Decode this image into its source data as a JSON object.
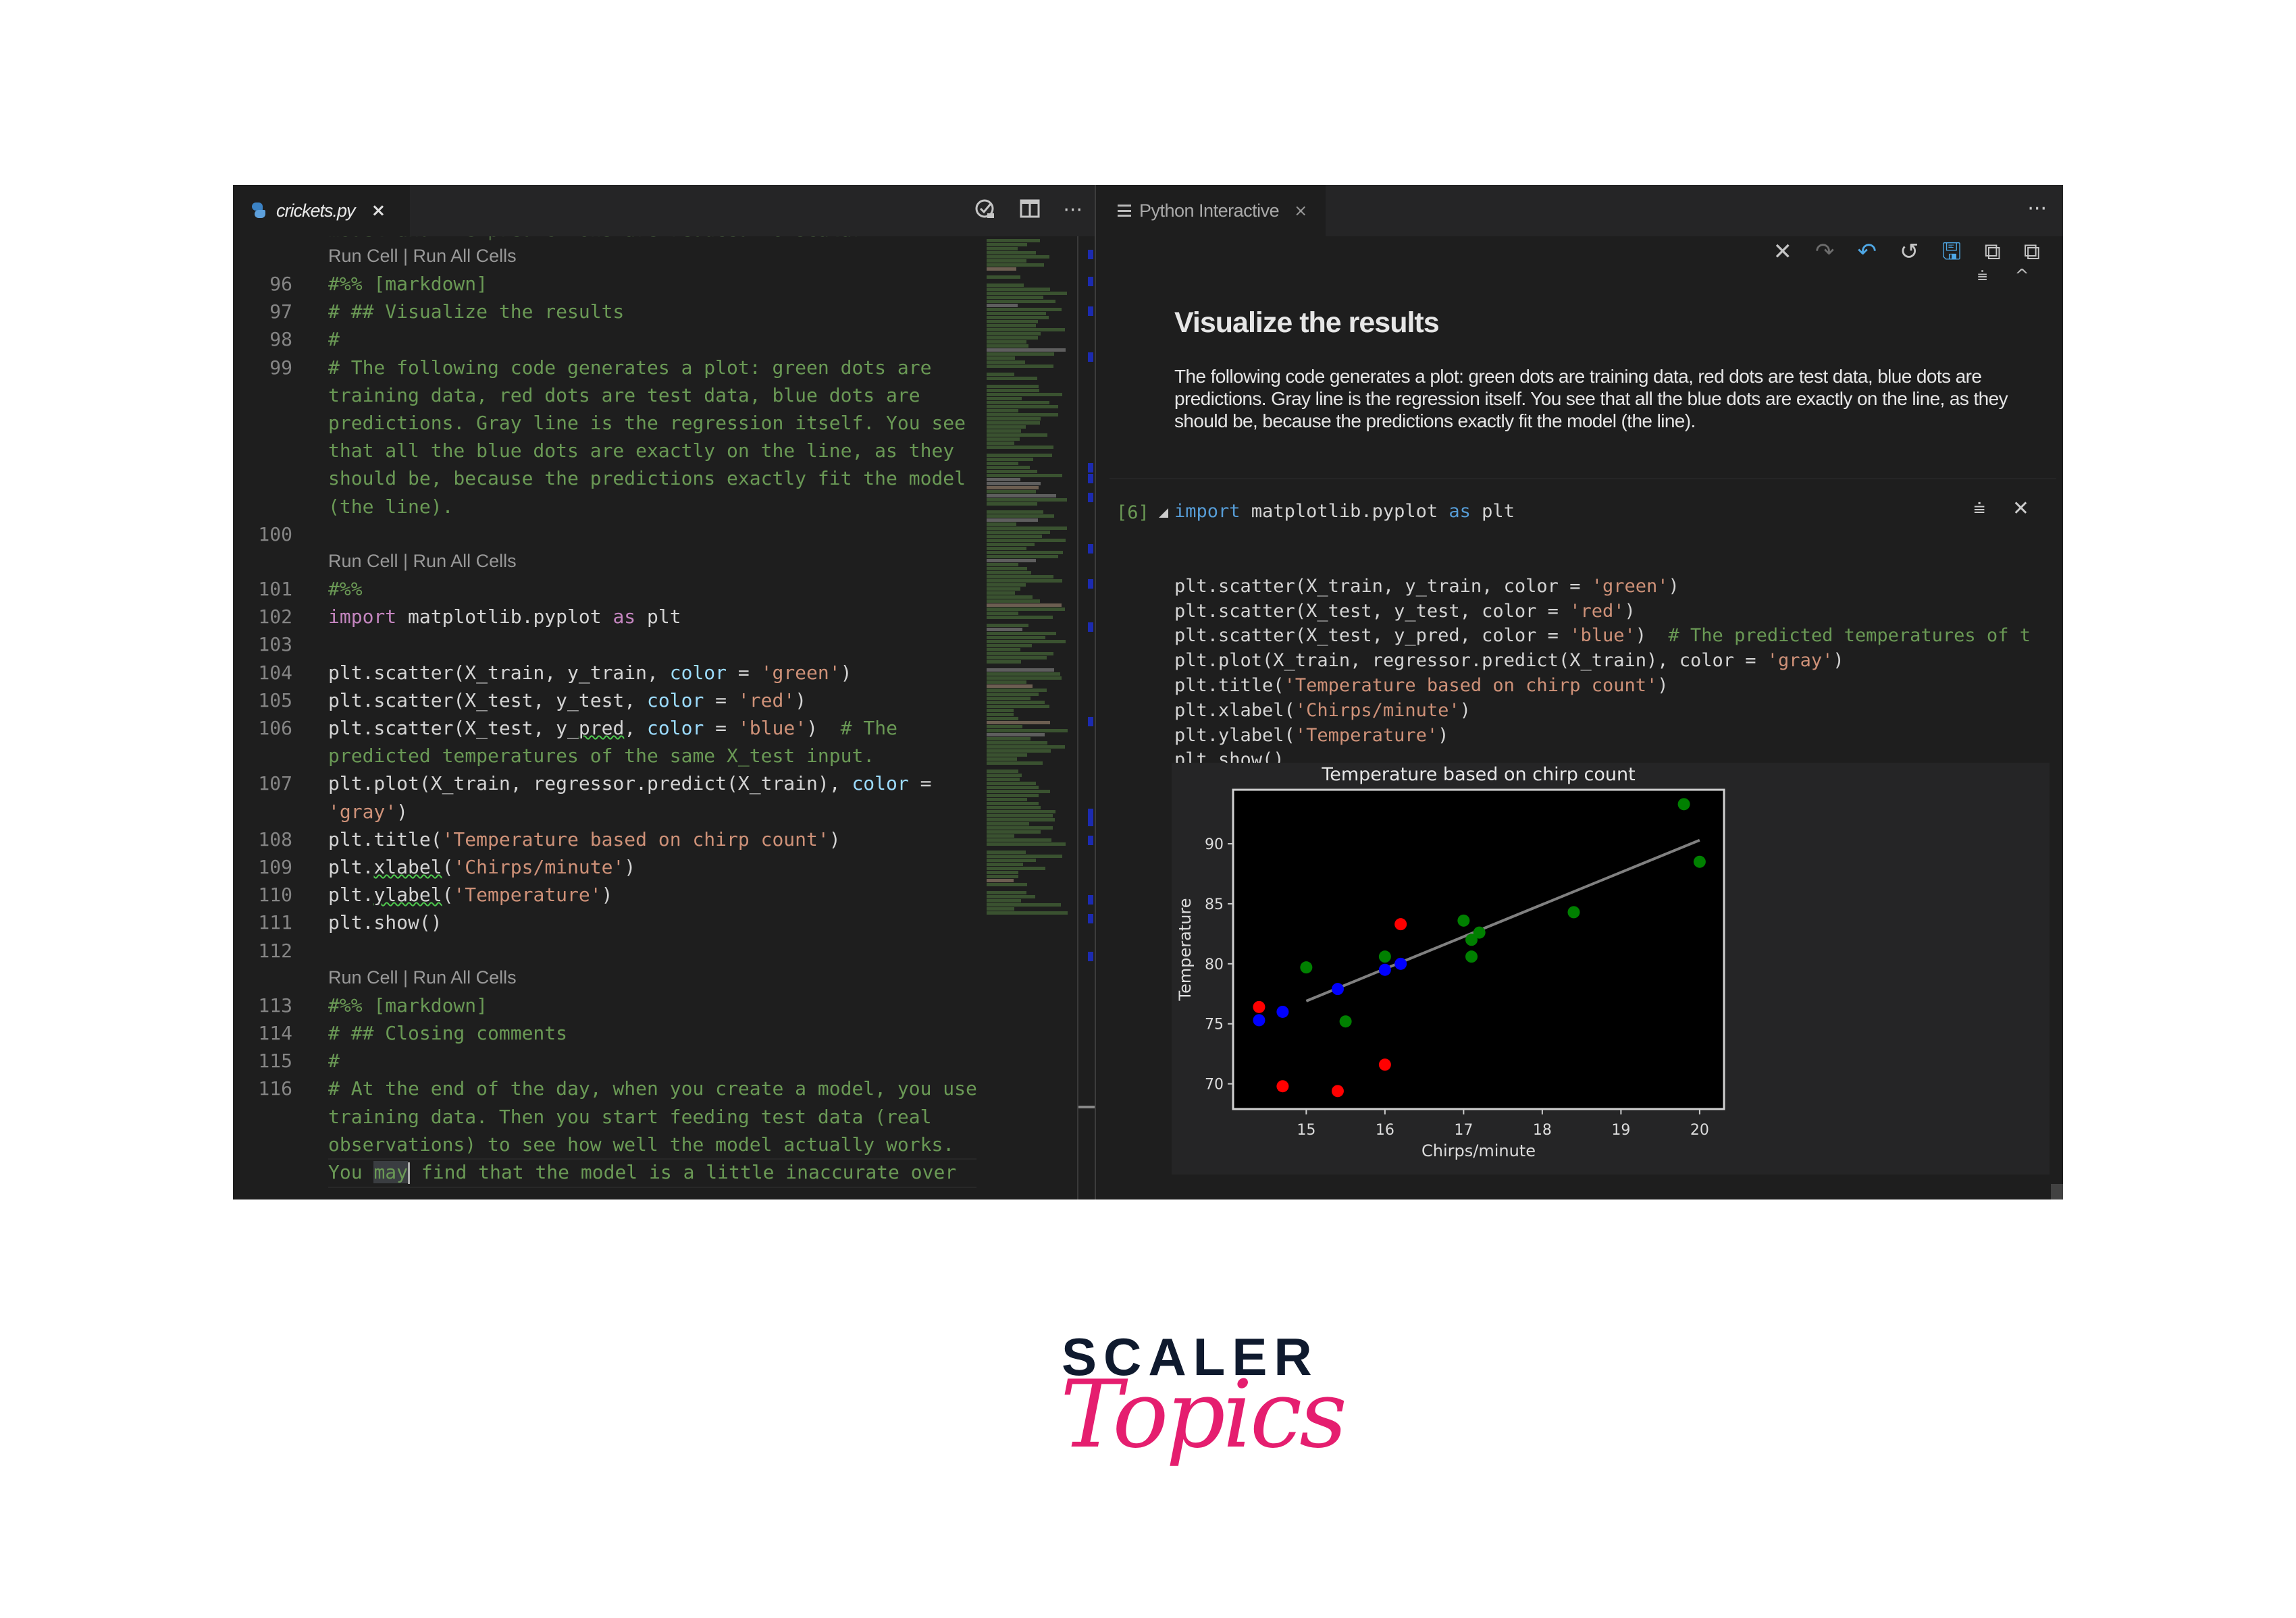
{
  "editor": {
    "tab": {
      "filename": "crickets.py",
      "close": "×"
    },
    "actions": {
      "open_changes": "open-changes",
      "split": "split-editor",
      "more": "···"
    },
    "clipped_line": "model and the predictions are reduced to scalar",
    "codelens": "Run Cell | Run All Cells",
    "lines": [
      {
        "num": "96",
        "parts": [
          {
            "t": "#%% [markdown]",
            "c": "cm"
          }
        ]
      },
      {
        "num": "97",
        "parts": [
          {
            "t": "# ## Visualize the results",
            "c": "cm"
          }
        ]
      },
      {
        "num": "98",
        "parts": [
          {
            "t": "#",
            "c": "cm"
          }
        ]
      },
      {
        "num": "99",
        "wrap": [
          [
            {
              "t": "# The following code generates a plot: green dots are",
              "c": "cm"
            }
          ],
          [
            {
              "t": "training data, red dots are test data, blue dots are",
              "c": "cm"
            }
          ],
          [
            {
              "t": "predictions. Gray line is the regression itself. You see",
              "c": "cm"
            }
          ],
          [
            {
              "t": "that all the blue dots are exactly on the line, as they",
              "c": "cm"
            }
          ],
          [
            {
              "t": "should be, because the predictions exactly fit the model",
              "c": "cm"
            }
          ],
          [
            {
              "t": "(the line).",
              "c": "cm"
            }
          ]
        ]
      },
      {
        "num": "100",
        "parts": []
      },
      {
        "num": "101",
        "parts": [
          {
            "t": "#%%",
            "c": "cm"
          }
        ]
      },
      {
        "num": "102",
        "parts": [
          {
            "t": "import",
            "c": "kw"
          },
          {
            "t": " matplotlib.pyplot ",
            "c": ""
          },
          {
            "t": "as",
            "c": "kw"
          },
          {
            "t": " plt",
            "c": ""
          }
        ]
      },
      {
        "num": "103",
        "parts": []
      },
      {
        "num": "104",
        "parts": [
          {
            "t": "plt.scatter(X_train, y_train, ",
            "c": ""
          },
          {
            "t": "color",
            "c": "param"
          },
          {
            "t": " = ",
            "c": ""
          },
          {
            "t": "'green'",
            "c": "str"
          },
          {
            "t": ")",
            "c": ""
          }
        ]
      },
      {
        "num": "105",
        "parts": [
          {
            "t": "plt.scatter(X_test, y_test, ",
            "c": ""
          },
          {
            "t": "color",
            "c": "param"
          },
          {
            "t": " = ",
            "c": ""
          },
          {
            "t": "'red'",
            "c": "str"
          },
          {
            "t": ")",
            "c": ""
          }
        ]
      },
      {
        "num": "106",
        "wrap": [
          [
            {
              "t": "plt.scatter(X_test, y_",
              "c": ""
            },
            {
              "t": "pred",
              "c": "sq"
            },
            {
              "t": ", ",
              "c": ""
            },
            {
              "t": "color",
              "c": "param"
            },
            {
              "t": " = ",
              "c": ""
            },
            {
              "t": "'blue'",
              "c": "str"
            },
            {
              "t": ")  ",
              "c": ""
            },
            {
              "t": "# The",
              "c": "cm"
            }
          ],
          [
            {
              "t": "predicted temperatures of the same X_test input.",
              "c": "cm"
            }
          ]
        ]
      },
      {
        "num": "107",
        "wrap": [
          [
            {
              "t": "plt.plot(X_train, regressor.predict(X_train), ",
              "c": ""
            },
            {
              "t": "color",
              "c": "param"
            },
            {
              "t": " =",
              "c": ""
            }
          ],
          [
            {
              "t": "'gray'",
              "c": "str"
            },
            {
              "t": ")",
              "c": ""
            }
          ]
        ]
      },
      {
        "num": "108",
        "parts": [
          {
            "t": "plt.title(",
            "c": ""
          },
          {
            "t": "'Temperature based on chirp count'",
            "c": "str"
          },
          {
            "t": ")",
            "c": ""
          }
        ]
      },
      {
        "num": "109",
        "parts": [
          {
            "t": "plt.",
            "c": ""
          },
          {
            "t": "xlabel",
            "c": "sq"
          },
          {
            "t": "(",
            "c": ""
          },
          {
            "t": "'Chirps/minute'",
            "c": "str"
          },
          {
            "t": ")",
            "c": ""
          }
        ]
      },
      {
        "num": "110",
        "parts": [
          {
            "t": "plt.",
            "c": ""
          },
          {
            "t": "ylabel",
            "c": "sq"
          },
          {
            "t": "(",
            "c": ""
          },
          {
            "t": "'Temperature'",
            "c": "str"
          },
          {
            "t": ")",
            "c": ""
          }
        ]
      },
      {
        "num": "111",
        "parts": [
          {
            "t": "plt.show()",
            "c": ""
          }
        ]
      },
      {
        "num": "112",
        "parts": []
      },
      {
        "num": "113",
        "parts": [
          {
            "t": "#%% [markdown]",
            "c": "cm"
          }
        ]
      },
      {
        "num": "114",
        "parts": [
          {
            "t": "# ## Closing comments",
            "c": "cm"
          }
        ]
      },
      {
        "num": "115",
        "parts": [
          {
            "t": "#",
            "c": "cm"
          }
        ]
      },
      {
        "num": "116",
        "wrap": [
          [
            {
              "t": "# At the end of the day, when you create a model, you use",
              "c": "cm"
            }
          ],
          [
            {
              "t": "training data. Then you start feeding test data (real",
              "c": "cm"
            }
          ],
          [
            {
              "t": "observations) to see how well the model actually works.",
              "c": "cm"
            }
          ],
          [
            {
              "t": "You ",
              "c": "cm"
            },
            {
              "t": "may",
              "c": "cm sel"
            },
            {
              "t": "|",
              "c": "cursor"
            },
            {
              "t": " find that the model is a little inaccurate over",
              "c": "cm"
            }
          ]
        ]
      }
    ]
  },
  "interactive": {
    "tab": {
      "title": "Python Interactive",
      "close": "×"
    },
    "more": "···",
    "toolbar": [
      {
        "name": "clear-all-icon",
        "glyph": "✕",
        "style": ""
      },
      {
        "name": "redo-icon",
        "glyph": "↷",
        "style": "dim"
      },
      {
        "name": "undo-icon",
        "glyph": "↶",
        "style": "blue"
      },
      {
        "name": "restart-kernel-icon",
        "glyph": "↺",
        "style": ""
      },
      {
        "name": "export-notebook-icon",
        "glyph": "🖫",
        "style": "blue"
      },
      {
        "name": "expand-all-icon",
        "glyph": "⧉",
        "style": ""
      },
      {
        "name": "collapse-all-icon",
        "glyph": "⧉",
        "style": ""
      }
    ],
    "markdown": {
      "heading": "Visualize the results",
      "body": "The following code generates a plot: green dots are training data, red dots are test data, blue dots are predictions. Gray line is the regression itself. You see that all the blue dots are exactly on the line, as they should be, because the predictions exactly fit the model (the line)."
    },
    "cell": {
      "exec_count": "[6]",
      "lines": [
        [
          {
            "t": "import",
            "c": "kw2"
          },
          {
            "t": " matplotlib.pyplot ",
            "c": ""
          },
          {
            "t": "as",
            "c": "kw2"
          },
          {
            "t": " plt",
            "c": ""
          }
        ],
        [],
        [
          {
            "t": "plt.scatter(X_train, y_train, color = ",
            "c": ""
          },
          {
            "t": "'green'",
            "c": "str"
          },
          {
            "t": ")",
            "c": ""
          }
        ],
        [
          {
            "t": "plt.scatter(X_test, y_test, color = ",
            "c": ""
          },
          {
            "t": "'red'",
            "c": "str"
          },
          {
            "t": ")",
            "c": ""
          }
        ],
        [
          {
            "t": "plt.scatter(X_test, y_pred, color = ",
            "c": ""
          },
          {
            "t": "'blue'",
            "c": "str"
          },
          {
            "t": ")  ",
            "c": ""
          },
          {
            "t": "# The predicted temperatures of t",
            "c": "cm"
          }
        ],
        [
          {
            "t": "plt.plot(X_train, regressor.predict(X_train), color = ",
            "c": ""
          },
          {
            "t": "'gray'",
            "c": "str"
          },
          {
            "t": ")",
            "c": ""
          }
        ],
        [
          {
            "t": "plt.title(",
            "c": ""
          },
          {
            "t": "'Temperature based on chirp count'",
            "c": "str"
          },
          {
            "t": ")",
            "c": ""
          }
        ],
        [
          {
            "t": "plt.xlabel(",
            "c": ""
          },
          {
            "t": "'Chirps/minute'",
            "c": "str"
          },
          {
            "t": ")",
            "c": ""
          }
        ],
        [
          {
            "t": "plt.ylabel(",
            "c": ""
          },
          {
            "t": "'Temperature'",
            "c": "str"
          },
          {
            "t": ")",
            "c": ""
          }
        ],
        [
          {
            "t": "plt.show()",
            "c": ""
          }
        ]
      ]
    }
  },
  "chart_data": {
    "type": "scatter",
    "title": "Temperature based on chirp count",
    "xlabel": "Chirps/minute",
    "ylabel": "Temperature",
    "xlim": [
      14.07,
      20.31
    ],
    "ylim": [
      67.9,
      94.5
    ],
    "xticks": [
      15,
      16,
      17,
      18,
      19,
      20
    ],
    "yticks": [
      70,
      75,
      80,
      85,
      90
    ],
    "grid": false,
    "legend": "none",
    "background": "#000000",
    "series": [
      {
        "name": "train",
        "color": "#008000",
        "points": [
          [
            15.0,
            79.7
          ],
          [
            15.5,
            75.2
          ],
          [
            16.0,
            80.6
          ],
          [
            17.0,
            83.6
          ],
          [
            17.1,
            82.0
          ],
          [
            17.2,
            82.6
          ],
          [
            17.1,
            80.6
          ],
          [
            18.4,
            84.3
          ],
          [
            19.8,
            93.3
          ],
          [
            20.0,
            88.5
          ]
        ]
      },
      {
        "name": "test",
        "color": "#ff0000",
        "points": [
          [
            14.4,
            76.4
          ],
          [
            14.7,
            69.8
          ],
          [
            15.4,
            69.4
          ],
          [
            16.0,
            71.6
          ],
          [
            16.2,
            83.3
          ]
        ]
      },
      {
        "name": "pred",
        "color": "#0000ff",
        "points": [
          [
            14.4,
            75.3
          ],
          [
            14.7,
            76.0
          ],
          [
            15.4,
            77.9
          ],
          [
            16.0,
            79.5
          ],
          [
            16.2,
            80.0
          ]
        ]
      }
    ],
    "line": {
      "name": "regression",
      "color": "#808080",
      "points": [
        [
          15.0,
          76.9
        ],
        [
          20.0,
          90.3
        ]
      ]
    }
  },
  "brand": {
    "line1": "SCALER",
    "line2": "Topics"
  }
}
